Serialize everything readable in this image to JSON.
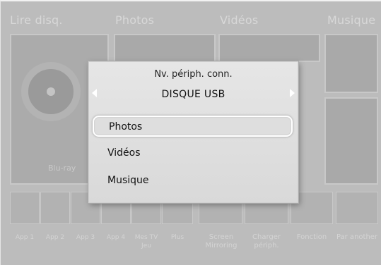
{
  "categories": [
    "Lire disq.",
    "Photos",
    "Vidéos",
    "Musique"
  ],
  "tiles": {
    "bluray_label": "Blu-ray"
  },
  "apps": [
    {
      "label": "App 1"
    },
    {
      "label": "App 2"
    },
    {
      "label": "App 3"
    },
    {
      "label": "App 4"
    },
    {
      "label": "Mes TV Jeu"
    },
    {
      "label": "Plus"
    },
    {
      "label": "Screen Mirroring"
    },
    {
      "label": "Charger périph."
    },
    {
      "label": "Fonction"
    },
    {
      "label": "Par another"
    }
  ],
  "popup": {
    "title": "Nv. périph. conn.",
    "device": "DISQUE USB",
    "items": [
      "Photos",
      "Vidéos",
      "Musique"
    ],
    "selected_index": 0
  }
}
